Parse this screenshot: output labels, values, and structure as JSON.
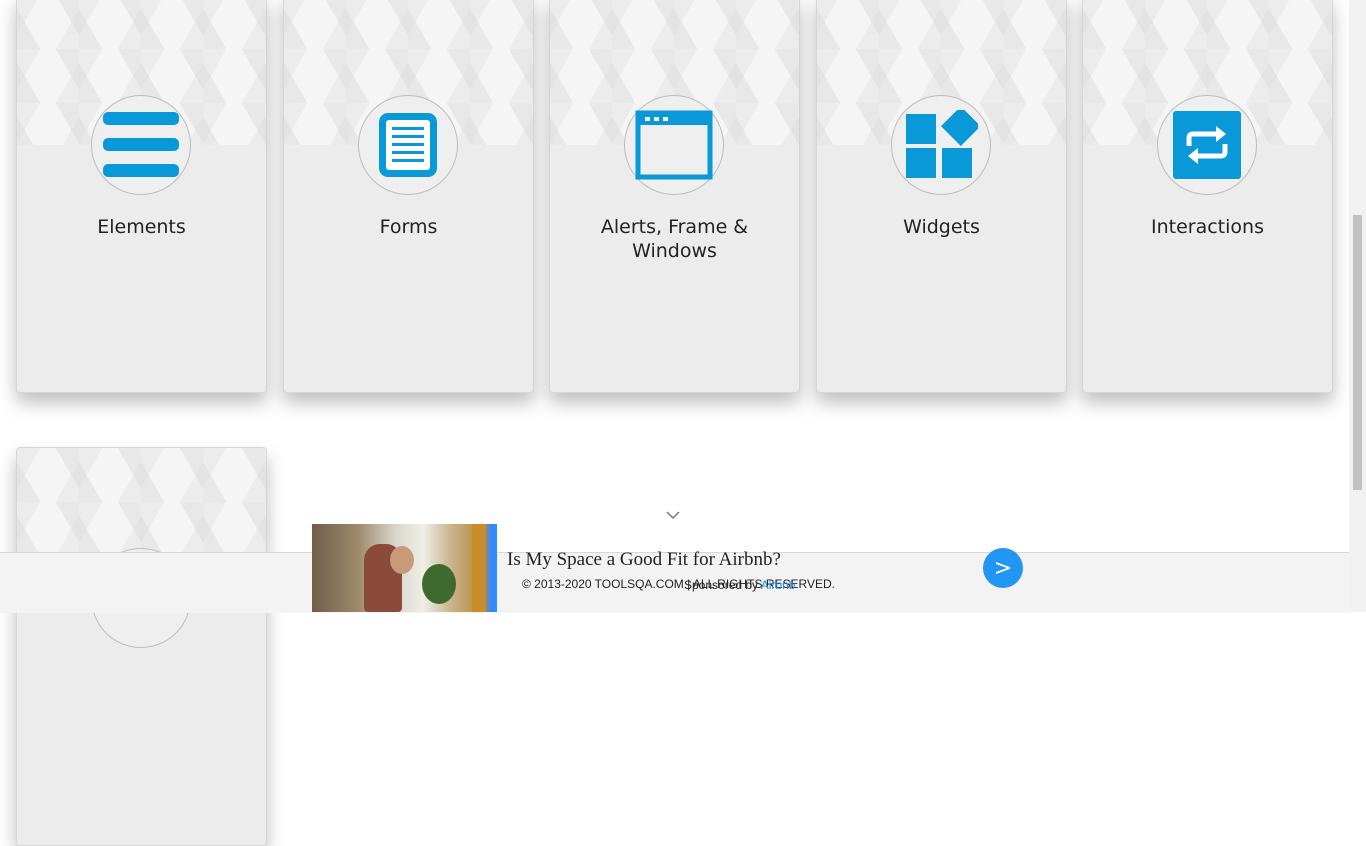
{
  "cards": [
    {
      "title": "Elements",
      "icon": "hamburger-menu-icon"
    },
    {
      "title": "Forms",
      "icon": "document-form-icon"
    },
    {
      "title": "Alerts, Frame & Windows",
      "icon": "browser-window-icon"
    },
    {
      "title": "Widgets",
      "icon": "widgets-grid-icon"
    },
    {
      "title": "Interactions",
      "icon": "repeat-arrows-icon"
    },
    {
      "title": "",
      "icon": "partial-card-icon"
    }
  ],
  "accent_color": "#0a99d8",
  "footer": {
    "copyright": "© 2013-2020 TOOLSQA.COM | ALL RIGHTS RESERVED."
  },
  "ad": {
    "title": "Is My Space a Good Fit for Airbnb?",
    "sponsored_prefix": "Sponsored by",
    "sponsored_brand": "Airbnb",
    "button_label": ">"
  }
}
